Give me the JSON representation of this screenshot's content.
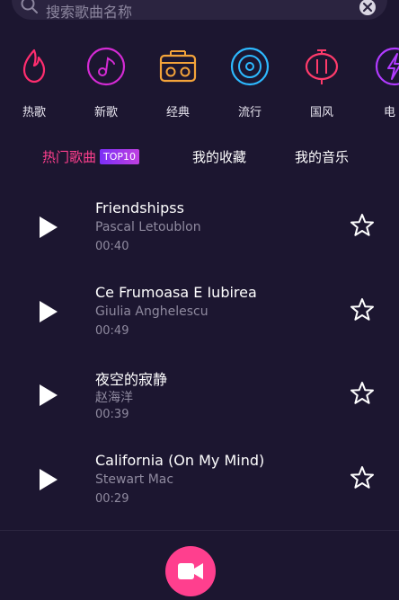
{
  "search": {
    "placeholder": "搜索歌曲名称"
  },
  "categories": [
    {
      "label": "热歌",
      "icon": "flame-icon",
      "color": "#ff2d6f"
    },
    {
      "label": "新歌",
      "icon": "music-note-icon",
      "color": "#d42bd4"
    },
    {
      "label": "经典",
      "icon": "radio-icon",
      "color": "#f3a33a"
    },
    {
      "label": "流行",
      "icon": "vinyl-disc-icon",
      "color": "#2db9ff"
    },
    {
      "label": "国风",
      "icon": "lantern-icon",
      "color": "#ff3b6b"
    },
    {
      "label": "电",
      "icon": "lightning-icon",
      "color": "#b13bff"
    }
  ],
  "tabs": {
    "hot": "热门歌曲",
    "hot_badge": "TOP10",
    "favorites": "我的收藏",
    "my_music": "我的音乐"
  },
  "songs": [
    {
      "title": "Friendshipss",
      "artist": "Pascal Letoublon",
      "duration": "00:40"
    },
    {
      "title": "Ce Frumoasa E Iubirea",
      "artist": "Giulia Anghelescu",
      "duration": "00:49"
    },
    {
      "title": "夜空的寂静",
      "artist": "赵海洋",
      "duration": "00:39"
    },
    {
      "title": "California (On My Mind)",
      "artist": "Stewart Mac",
      "duration": "00:29"
    }
  ],
  "colors": {
    "accent": "#ff3f8e",
    "background": "#1c1630"
  }
}
